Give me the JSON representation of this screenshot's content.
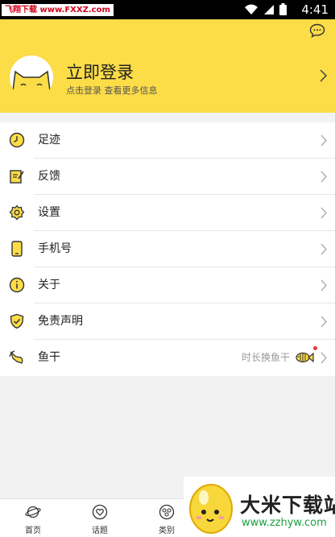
{
  "status_bar": {
    "watermark": "飞翔下载 www.FXXZ.com",
    "time": "4:41"
  },
  "header": {
    "title": "立即登录",
    "subtitle": "点击登录 查看更多信息",
    "bg_color": "#fcdc47"
  },
  "menu": [
    {
      "label": "足迹",
      "icon": "clock-icon"
    },
    {
      "label": "反馈",
      "icon": "feedback-note-icon"
    },
    {
      "label": "设置",
      "icon": "gear-icon"
    },
    {
      "label": "手机号",
      "icon": "phone-icon"
    },
    {
      "label": "关于",
      "icon": "info-icon"
    },
    {
      "label": "免责声明",
      "icon": "shield-check-icon"
    },
    {
      "label": "鱼干",
      "icon": "dried-fish-icon",
      "extra": "时长换鱼干",
      "badge_color": "#e53935"
    }
  ],
  "tabbar": [
    {
      "label": "首页",
      "icon": "planet-icon"
    },
    {
      "label": "话题",
      "icon": "topic-heart-icon"
    },
    {
      "label": "类别",
      "icon": "category-icon"
    }
  ],
  "brand_watermark": {
    "name": "大米下载站",
    "url": "www.zzhyw.com"
  }
}
